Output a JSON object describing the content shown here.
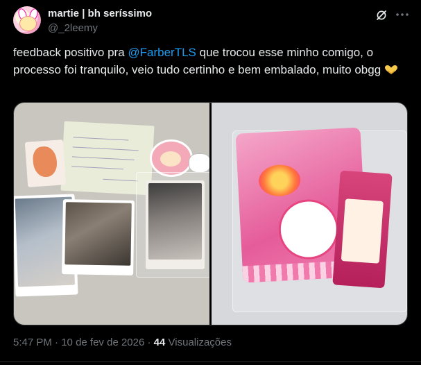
{
  "author": {
    "display_name": "martie | bh seríssimo",
    "handle": "@_2leemy"
  },
  "tweet": {
    "text_before": "feedback positivo pra ",
    "mention": "@FarberTLS",
    "text_after": " que trocou esse minho comigo, o processo foi tranquilo, veio tudo certinho e bem embalado, muito obgg ",
    "emoji": "heart-hands-icon"
  },
  "media": {
    "count": 2
  },
  "meta": {
    "time": "5:47 PM",
    "separator": "·",
    "date": "10 de fev de 2026",
    "views_count": "44",
    "views_label": "Visualizações"
  },
  "icons": {
    "grok": "grok-icon",
    "more": "more-icon"
  },
  "colors": {
    "background": "#000000",
    "text": "#e7e9ea",
    "secondary": "#71767b",
    "link": "#1d9bf0",
    "border": "#2f3336"
  }
}
